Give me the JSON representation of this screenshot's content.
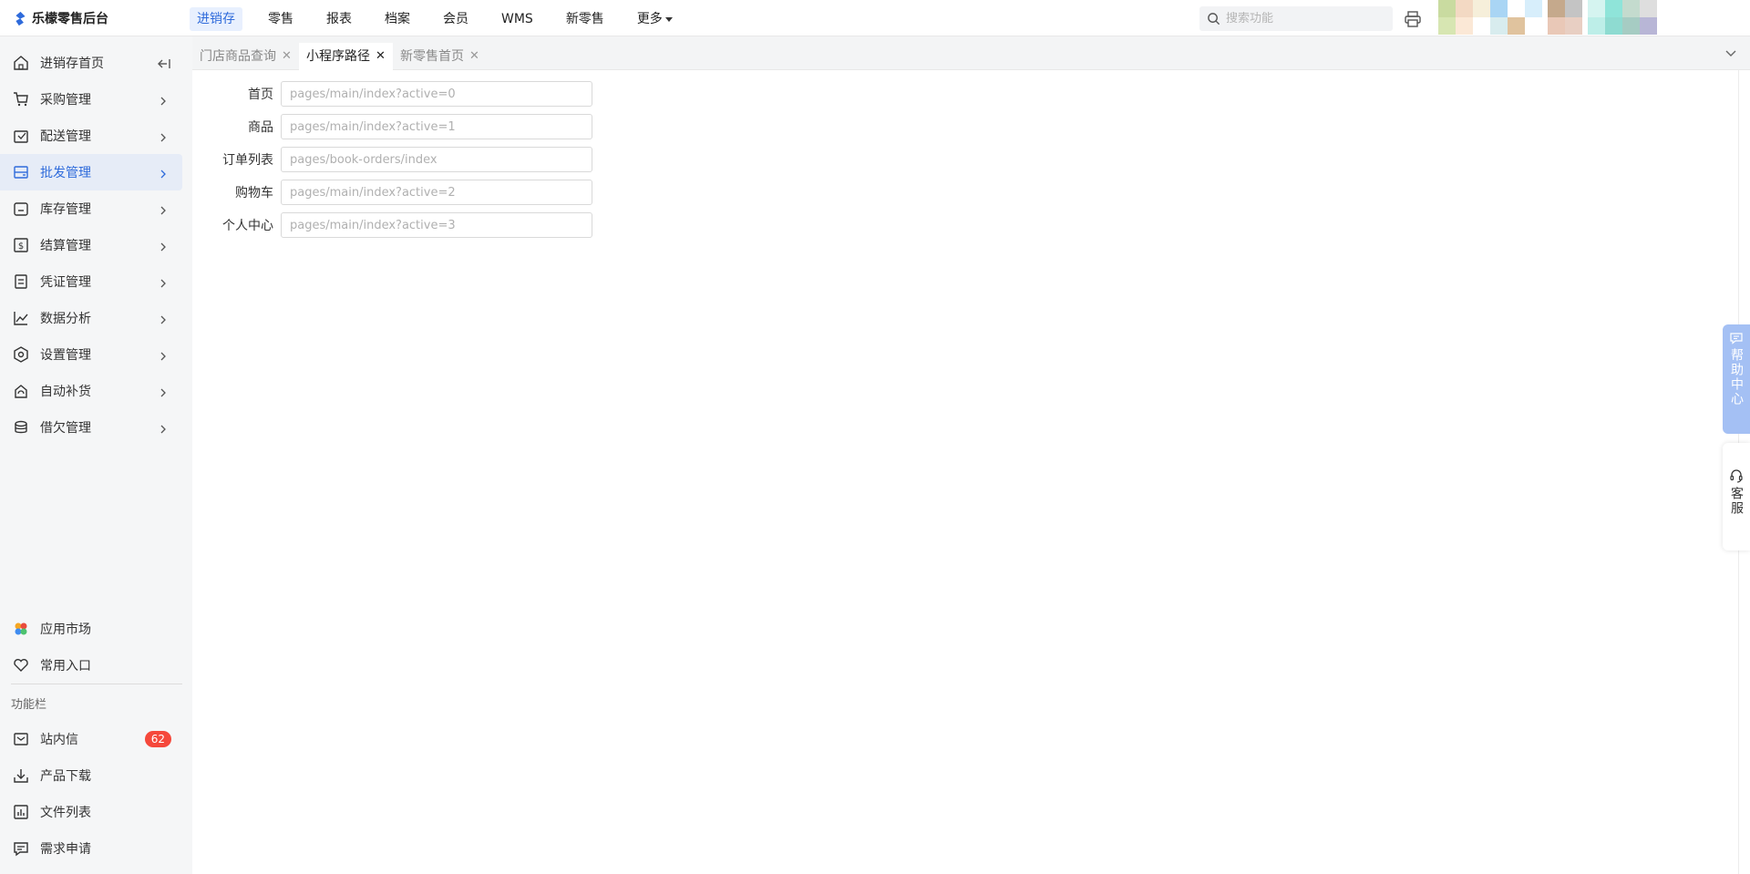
{
  "app": {
    "title": "乐檬零售后台"
  },
  "topnav": {
    "items": [
      "进销存",
      "零售",
      "报表",
      "档案",
      "会员",
      "WMS",
      "新零售",
      "更多"
    ],
    "active_index": 0
  },
  "search": {
    "placeholder": "搜索功能"
  },
  "sidebar": {
    "menu": [
      {
        "label": "进销存首页",
        "icon": "home-icon"
      },
      {
        "label": "采购管理",
        "icon": "cart-icon"
      },
      {
        "label": "配送管理",
        "icon": "delivery-icon"
      },
      {
        "label": "批发管理",
        "icon": "wholesale-icon",
        "active": true
      },
      {
        "label": "库存管理",
        "icon": "inventory-icon"
      },
      {
        "label": "结算管理",
        "icon": "settlement-icon"
      },
      {
        "label": "凭证管理",
        "icon": "voucher-icon"
      },
      {
        "label": "数据分析",
        "icon": "chart-icon"
      },
      {
        "label": "设置管理",
        "icon": "settings-icon"
      },
      {
        "label": "自动补货",
        "icon": "replenish-icon"
      },
      {
        "label": "借欠管理",
        "icon": "debt-icon"
      }
    ],
    "bottom": [
      {
        "label": "应用市场",
        "icon": "app-market-icon"
      },
      {
        "label": "常用入口",
        "icon": "heart-icon"
      }
    ],
    "section_title": "功能栏",
    "tools": [
      {
        "label": "站内信",
        "icon": "mail-icon",
        "badge": "62"
      },
      {
        "label": "产品下载",
        "icon": "download-icon"
      },
      {
        "label": "文件列表",
        "icon": "file-list-icon"
      },
      {
        "label": "需求申请",
        "icon": "request-icon"
      }
    ]
  },
  "tabs": [
    {
      "label": "门店商品查询",
      "active": false
    },
    {
      "label": "小程序路径",
      "active": true
    },
    {
      "label": "新零售首页",
      "active": false
    }
  ],
  "form": {
    "rows": [
      {
        "label": "首页",
        "placeholder": "pages/main/index?active=0"
      },
      {
        "label": "商品",
        "placeholder": "pages/main/index?active=1"
      },
      {
        "label": "订单列表",
        "placeholder": "pages/book-orders/index"
      },
      {
        "label": "购物车",
        "placeholder": "pages/main/index?active=2"
      },
      {
        "label": "个人中心",
        "placeholder": "pages/main/index?active=3"
      }
    ]
  },
  "floating": {
    "help": "帮助中心",
    "service": "客服"
  },
  "colors": {
    "accent": "#2f6bdb",
    "badge": "#f5483b",
    "help_tab": "#a4c0f4",
    "sidebar_bg": "#f5f6f7"
  }
}
